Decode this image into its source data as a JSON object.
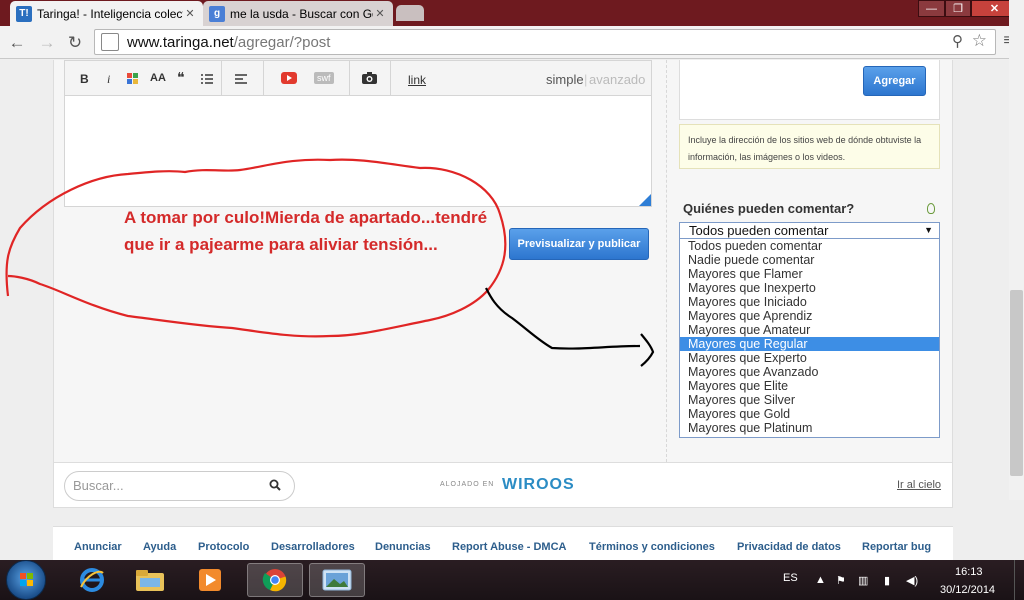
{
  "browser": {
    "tabs": [
      {
        "title": "Taringa! - Inteligencia colectiva",
        "favicon": "T!"
      },
      {
        "title": "me la usda - Buscar con Google",
        "favicon": "g"
      }
    ],
    "url_host": "www.taringa.net",
    "url_path": "/agregar/?post",
    "window_min": "—",
    "window_max": "❐",
    "window_close": "✕"
  },
  "editor": {
    "toolbar": {
      "bold": "B",
      "italic": "i",
      "size": "AA",
      "quote": "❝",
      "link": "link",
      "swf": "swf",
      "mode_simple": "simple",
      "mode_separator": "|",
      "mode_advanced": "avanzado"
    },
    "publish_label": "Previsualizar y publicar"
  },
  "sidebar": {
    "add_label": "Agregar",
    "hint": "Incluye la dirección de los sitios web de dónde obtuviste la información, las imágenes o los videos.",
    "comment_label": "Quiénes pueden comentar?",
    "comment_selected": "Todos pueden comentar",
    "comment_options": [
      "Todos pueden comentar",
      "Nadie puede comentar",
      "Mayores que Flamer",
      "Mayores que Inexperto",
      "Mayores que Iniciado",
      "Mayores que Aprendiz",
      "Mayores que Amateur",
      "Mayores que Regular",
      "Mayores que Experto",
      "Mayores que Avanzado",
      "Mayores que Elite",
      "Mayores que Silver",
      "Mayores que Gold",
      "Mayores que Platinum"
    ],
    "highlighted_option": "Mayores que Regular"
  },
  "footer": {
    "search_placeholder": "Buscar...",
    "hosted_label": "ALOJADO EN",
    "hosted_brand": "WIROOS",
    "sky_link": "Ir al cielo",
    "links": [
      "Anunciar",
      "Ayuda",
      "Protocolo",
      "Desarrolladores",
      "Denuncias",
      "Report Abuse - DMCA",
      "Términos y condiciones",
      "Privacidad de datos",
      "Reportar bug"
    ]
  },
  "annotation": {
    "text": "A tomar por culo!Mierda de apartado...tendré que ir a pajearme para aliviar tensión...",
    "color": "#d42a2a"
  },
  "taskbar": {
    "language": "ES",
    "time": "16:13",
    "date": "30/12/2014",
    "icons": [
      "ie-icon",
      "explorer-icon",
      "media-player-icon",
      "chrome-icon",
      "photo-viewer-icon"
    ]
  }
}
